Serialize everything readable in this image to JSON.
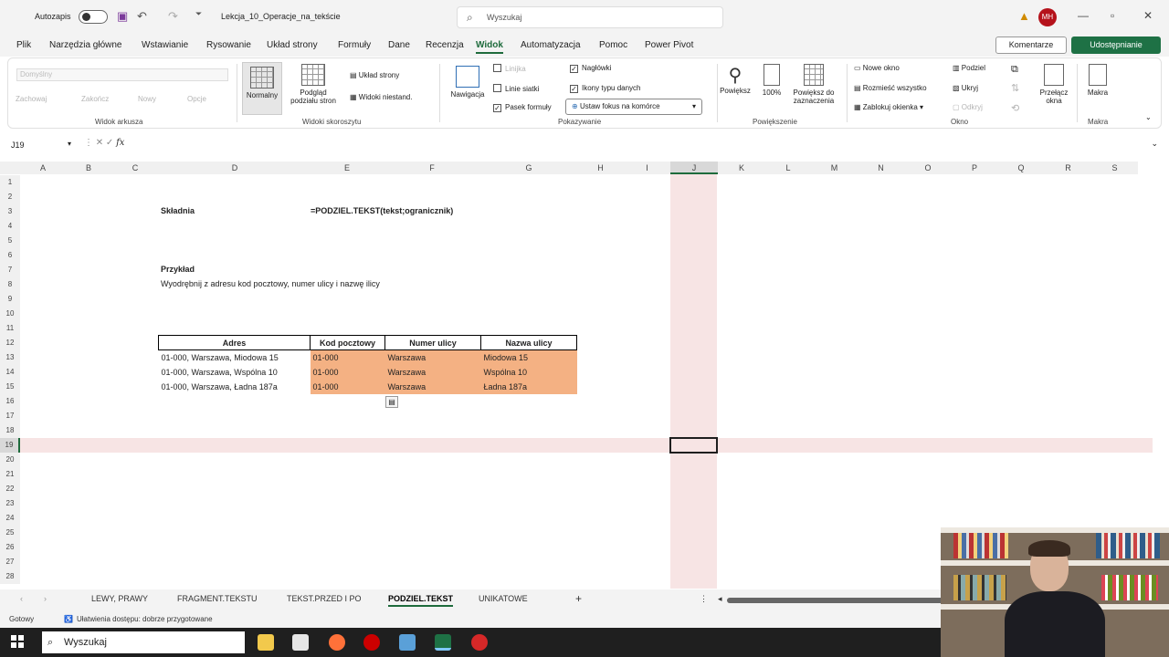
{
  "titlebar": {
    "autosave_label": "Autozapis",
    "filename": "Lekcja_10_Operacje_na_tekście",
    "search_placeholder": "Wyszukaj",
    "user_initials": "MH"
  },
  "menu": [
    "Plik",
    "Narzędzia główne",
    "Wstawianie",
    "Rysowanie",
    "Układ strony",
    "Formuły",
    "Dane",
    "Recenzja",
    "Widok",
    "Automatyzacja",
    "Pomoc",
    "Power Pivot"
  ],
  "menu_active": "Widok",
  "comments_label": "Komentarze",
  "share_label": "Udostępnianie",
  "ribbon": {
    "sheet_view": {
      "dropdown": "Domyślny",
      "keep": "Zachowaj",
      "exit": "Zakończ",
      "new": "Nowy",
      "options": "Opcje",
      "label": "Widok arkusza"
    },
    "workbook_views": {
      "normal": "Normalny",
      "page_break": "Podgląd podziału stron",
      "page_layout": "Układ strony",
      "custom": "Widoki niestand.",
      "label": "Widoki skoroszytu"
    },
    "show": {
      "navigation": "Nawigacja",
      "ruler": "Linijka",
      "gridlines": "Linie siatki",
      "formula_bar": "Pasek formuły",
      "headings": "Nagłówki",
      "icons": "Ikony typu danych",
      "focus": "Ustaw fokus na komórce",
      "label": "Pokazywanie"
    },
    "zoom": {
      "zoom": "Powiększ",
      "hundred": "100%",
      "to_selection": "Powiększ do zaznaczenia",
      "label": "Powiększenie"
    },
    "window": {
      "new_window": "Nowe okno",
      "arrange": "Rozmieść wszystko",
      "freeze": "Zablokuj okienka",
      "split": "Podziel",
      "hide": "Ukryj",
      "unhide": "Odkryj",
      "switch": "Przełącz okna",
      "label": "Okno"
    },
    "macros": {
      "macros": "Makra",
      "label": "Makra"
    }
  },
  "formula_bar": {
    "name_box": "J19"
  },
  "columns": [
    "A",
    "B",
    "C",
    "D",
    "E",
    "F",
    "G",
    "H",
    "I",
    "J",
    "K",
    "L",
    "M",
    "N",
    "O",
    "P",
    "Q",
    "R",
    "S"
  ],
  "rows": [
    "1",
    "2",
    "3",
    "4",
    "5",
    "6",
    "7",
    "8",
    "9",
    "10",
    "11",
    "12",
    "13",
    "14",
    "15",
    "16",
    "17",
    "18",
    "19",
    "20",
    "21",
    "22",
    "23",
    "24",
    "25",
    "26",
    "27",
    "28"
  ],
  "sheet": {
    "syntax_label": "Składnia",
    "syntax_formula": "=PODZIEL.TEKST(tekst;ogranicznik)",
    "example_label": "Przykład",
    "example_desc": "Wyodrębnij z adresu kod pocztowy, numer ulicy i nazwę ilicy",
    "table": {
      "headers": [
        "Adres",
        "Kod pocztowy",
        "Numer ulicy",
        "Nazwa ulicy"
      ],
      "rows": [
        [
          "01-000, Warszawa, Miodowa 15",
          "01-000",
          "Warszawa",
          "Miodowa 15"
        ],
        [
          "01-000, Warszawa, Wspólna 10",
          "01-000",
          "Warszawa",
          "Wspólna 10"
        ],
        [
          "01-000, Warszawa, Ładna 187a",
          "01-000",
          "Warszawa",
          "Ładna 187a"
        ]
      ]
    }
  },
  "sheet_tabs": [
    "LEWY, PRAWY",
    "FRAGMENT.TEKSTU",
    "TEKST.PRZED I PO",
    "PODZIEL.TEKST",
    "UNIKATOWE"
  ],
  "active_tab": "PODZIEL.TEKST",
  "status": {
    "ready": "Gotowy",
    "accessibility": "Ułatwienia dostępu: dobrze przygotowane"
  },
  "taskbar": {
    "search": "Wyszukaj"
  },
  "colors": {
    "accent": "#1e6b3c",
    "highlight": "#f4b183",
    "crosshair": "#f7e4e4"
  }
}
